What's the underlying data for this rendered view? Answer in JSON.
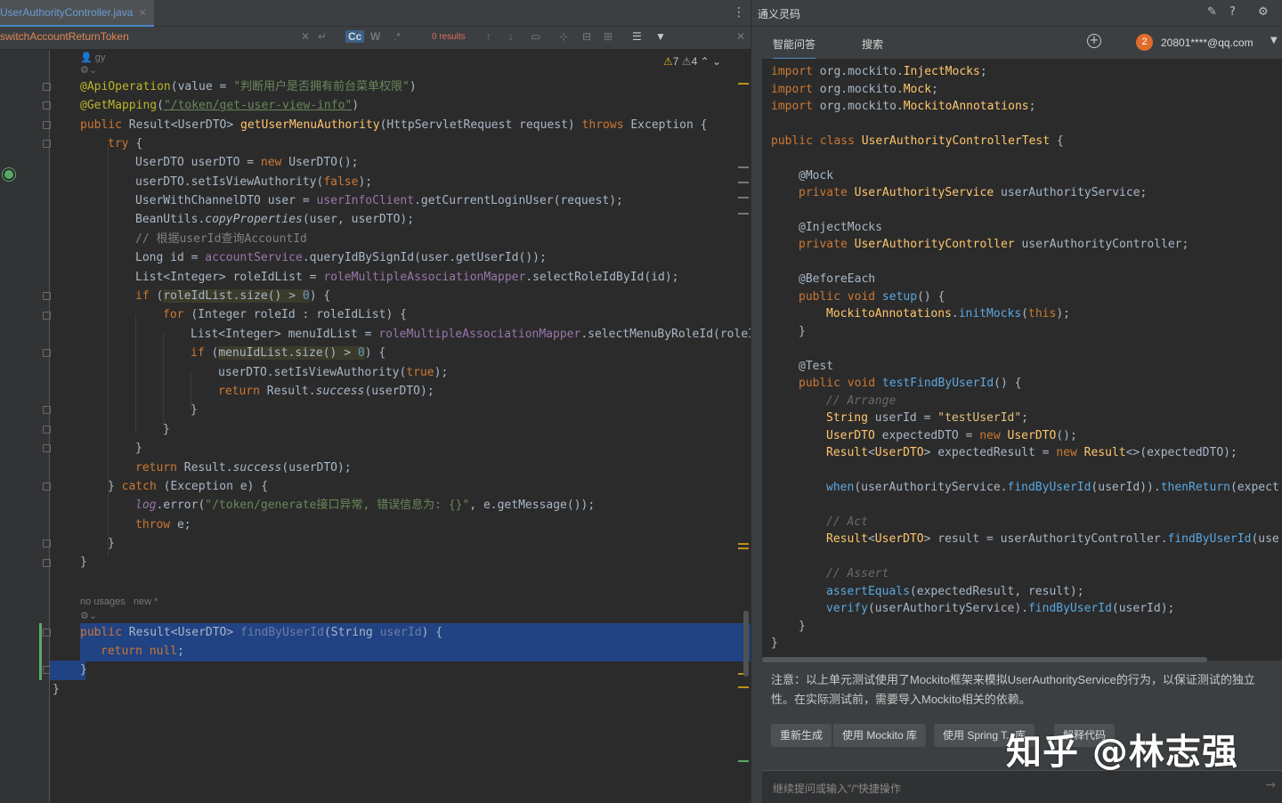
{
  "editor": {
    "tab_label": "UserAuthorityController.java",
    "find_query": "switchAccountReturnToken",
    "find_case_label": "Cc",
    "find_word_label": "W",
    "find_results": "0 results",
    "inspection_warnings": "7",
    "inspection_weak": "4",
    "author_hint": "gy",
    "usages_hint": "no usages",
    "new_hint": "new *"
  },
  "code": {
    "l1_ann": "@ApiOperation",
    "l1_pre": "(value = ",
    "l1_str": "\"判断用户是否拥有前台菜单权限\"",
    "l1_post": ")",
    "l2_ann": "@GetMapping",
    "l2_pre": "(",
    "l2_str": "\"/token/get-user-view-info\"",
    "l2_post": ")",
    "l3_kw": "public ",
    "l3_type": "Result<UserDTO> ",
    "l3_fn": "getUserMenuAuthority",
    "l3_params": "(HttpServletRequest request) ",
    "l3_kw2": "throws ",
    "l3_rest": "Exception {",
    "l4_kw": "try ",
    "l4_rest": "{",
    "l5_pre": "UserDTO userDTO = ",
    "l5_kw": "new ",
    "l5_post": "UserDTO();",
    "l6_pre": "userDTO.setIsViewAuthority(",
    "l6_kw": "false",
    "l6_post": ");",
    "l7_pre": "UserWithChannelDTO user = ",
    "l7_fld": "userInfoClient",
    "l7_post": ".getCurrentLoginUser(request);",
    "l8_pre": "BeanUtils.",
    "l8_it": "copyProperties",
    "l8_post": "(user, userDTO);",
    "l9_cm": "// 根据userId查询AccountId",
    "l10_pre": "Long id = ",
    "l10_fld": "accountService",
    "l10_post": ".queryIdBySignId(user.getUserId());",
    "l11_pre": "List<Integer> roleIdList = ",
    "l11_fld": "roleMultipleAssociationMapper",
    "l11_post": ".selectRoleIdById(id);",
    "l12_kw": "if ",
    "l12_pre": "(",
    "l12_hl": "roleIdList.size() > ",
    "l12_num": "0",
    "l12_post": ") {",
    "l13_kw": "for ",
    "l13_rest": "(Integer roleId : roleIdList) {",
    "l14_pre": "List<Integer> menuIdList = ",
    "l14_fld": "roleMultipleAssociationMapper",
    "l14_post": ".selectMenuByRoleId(roleI",
    "l15_kw": "if ",
    "l15_pre": "(",
    "l15_hl": "menuIdList.size() > ",
    "l15_num": "0",
    "l15_post": ") {",
    "l16_pre": "userDTO.setIsViewAuthority(",
    "l16_kw": "true",
    "l16_post": ");",
    "l17_kw": "return ",
    "l17_pre": "Result.",
    "l17_it": "success",
    "l17_post": "(userDTO);",
    "l18": "}",
    "l19": "}",
    "l20": "}",
    "l21_kw": "return ",
    "l21_pre": "Result.",
    "l21_it": "success",
    "l21_post": "(userDTO);",
    "l22_pre": "} ",
    "l22_kw": "catch ",
    "l22_post": "(Exception e) {",
    "l23_fld": "log",
    "l23_pre": ".error(",
    "l23_str": "\"/token/generate接口异常, 错误信息为: {}\"",
    "l23_post": ", e.getMessage());",
    "l24_kw": "throw ",
    "l24_post": "e;",
    "l25": "}",
    "l26": "}",
    "l27_kw": "public ",
    "l27_type": "Result<UserDTO> ",
    "l27_fn": "findByUserId",
    "l27_pre": "(String ",
    "l27_param": "userId",
    "l27_post": ") {",
    "l28_kw": "return ",
    "l28_null": "null",
    "l28_post": ";",
    "l29": "}",
    "l30": "}"
  },
  "panel": {
    "title": "通义灵码",
    "tab_qa": "智能问答",
    "tab_search": "搜索",
    "avatar_num": "2",
    "user_email": "20801****@qq.com",
    "code": [
      "import org.mockito.InjectMocks;",
      "import org.mockito.Mock;",
      "import org.mockito.MockitoAnnotations;",
      "public class UserAuthorityControllerTest {",
      "@Mock",
      "private UserAuthorityService userAuthorityService;",
      "@InjectMocks",
      "private UserAuthorityController userAuthorityController;",
      "@BeforeEach",
      "public void setup() {",
      "MockitoAnnotations.initMocks(this);",
      "}",
      "@Test",
      "public void testFindByUserId() {",
      "// Arrange",
      "String userId = \"testUserId\";",
      "UserDTO expectedDTO = new UserDTO();",
      "Result<UserDTO> expectedResult = new Result<>(expectedDTO);",
      "when(userAuthorityService.findByUserId(userId)).thenReturn(expect",
      "// Act",
      "Result<UserDTO> result = userAuthorityController.findByUserId(use",
      "// Assert",
      "assertEquals(expectedResult, result);",
      "verify(userAuthorityService).findByUserId(userId);",
      "}",
      "}"
    ],
    "note": "注意：以上单元测试使用了Mockito框架来模拟UserAuthorityService的行为，以保证测试的独立性。在实际测试前，需要导入Mockito相关的依赖。",
    "chip_regen": "重新生成",
    "chip_mockito": "使用 Mockito 库",
    "chip_spring": "使用 Spring T...库",
    "chip_explain": "解释代码",
    "input_placeholder": "继续提问或输入\"/\"快捷操作",
    "watermark": "知乎 @林志强"
  }
}
